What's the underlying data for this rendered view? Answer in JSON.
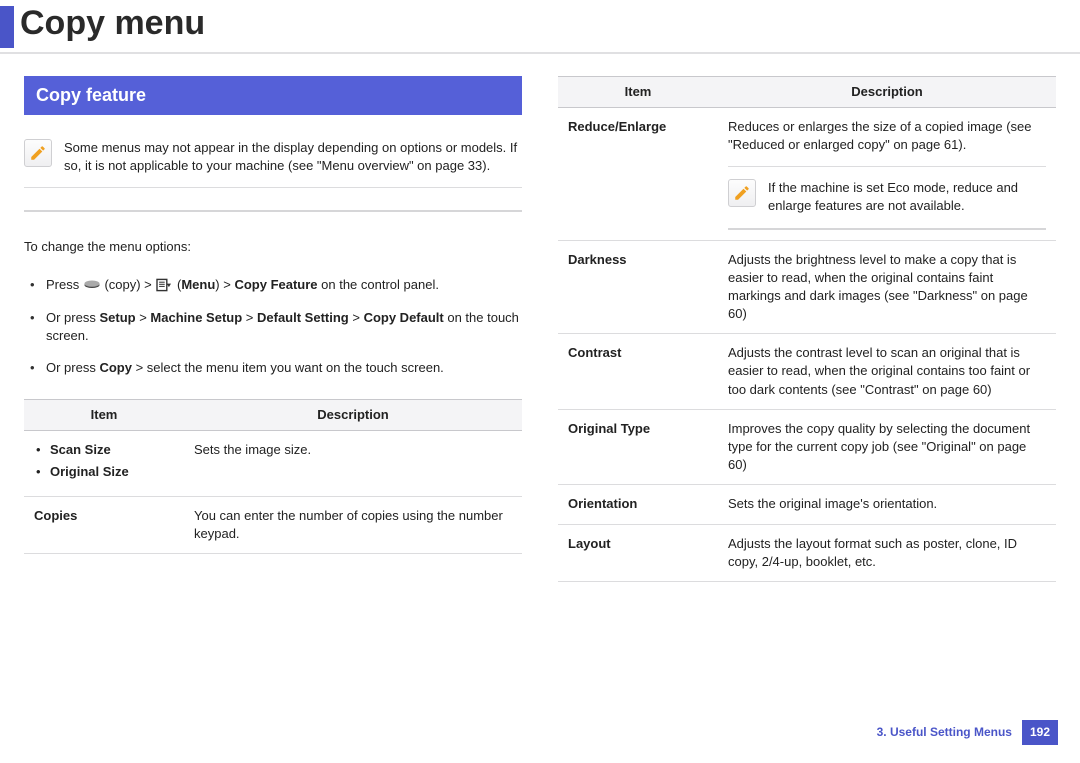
{
  "page_title": "Copy menu",
  "section_title": "Copy feature",
  "note1": "Some menus may not appear in the display depending on options or models. If so, it is not applicable to your machine (see \"Menu overview\" on page 33).",
  "intro": "To change the menu options:",
  "steps": {
    "s1a": "Press ",
    "s1b": " (copy) > ",
    "s1c": " (",
    "s1d": "Menu",
    "s1e": ") > ",
    "s1f": "Copy Feature",
    "s1g": " on the control panel.",
    "s2a": "Or press ",
    "s2b": "Setup",
    "s2c": " > ",
    "s2d": "Machine Setup",
    "s2e": " > ",
    "s2f": "Default Setting",
    "s2g": " > ",
    "s2h": "Copy Default",
    "s2i": " on the touch screen.",
    "s3a": "Or press ",
    "s3b": "Copy",
    "s3c": " > select the menu item you want on the touch screen."
  },
  "th_item": "Item",
  "th_desc": "Description",
  "left_table": {
    "r1_item1": "Scan Size",
    "r1_item2": "Original Size",
    "r1_desc": "Sets the image size.",
    "r2_item": "Copies",
    "r2_desc": "You can enter the number of copies using the number keypad."
  },
  "right_table": {
    "r1_item": "Reduce/Enlarge",
    "r1_desc": "Reduces or enlarges the size of a copied image (see \"Reduced or enlarged copy\" on page 61).",
    "r1_note": "If the machine is set Eco mode, reduce and enlarge features are not available.",
    "r2_item": "Darkness",
    "r2_desc": "Adjusts the brightness level to make a copy that is easier to read, when the original contains faint markings and dark images (see \"Darkness\" on page 60)",
    "r3_item": "Contrast",
    "r3_desc": "Adjusts the contrast level to scan an original that is easier to read, when the original contains too faint or too dark contents (see \"Contrast\" on page 60)",
    "r4_item": "Original Type",
    "r4_desc": "Improves the copy quality by selecting the document type for the current copy job (see \"Original\" on page 60)",
    "r5_item": "Orientation",
    "r5_desc": "Sets the original image's orientation.",
    "r6_item": "Layout",
    "r6_desc": "Adjusts the layout format such as poster, clone, ID copy, 2/4-up, booklet, etc."
  },
  "footer": {
    "chapter": "3.  Useful Setting Menus",
    "page": "192"
  }
}
